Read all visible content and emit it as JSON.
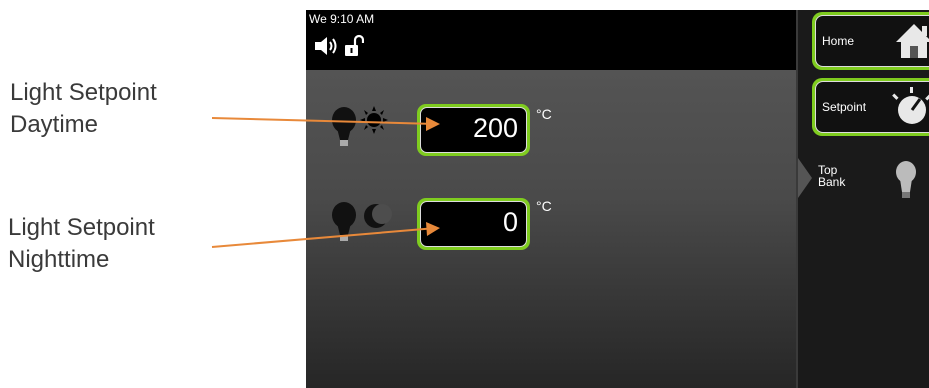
{
  "annotations": {
    "day_line1": "Light Setpoint",
    "day_line2": "Daytime",
    "night_line1": "Light Setpoint",
    "night_line2": "Nighttime",
    "arrow_color": "#e8893a"
  },
  "status": {
    "datetime": "We 9:10 AM",
    "icons": [
      "speaker-icon",
      "unlock-icon"
    ]
  },
  "setpoints": {
    "daytime": {
      "value": "200",
      "unit": "°C",
      "icon": "bulb-sun-icon"
    },
    "nighttime": {
      "value": "0",
      "unit": "°C",
      "icon": "bulb-moon-icon"
    }
  },
  "sidebar": {
    "home_label": "Home",
    "setpoint_label": "Setpoint",
    "top_line1": "Top",
    "top_line2": "Bank",
    "accent": "#7fcc1f"
  }
}
